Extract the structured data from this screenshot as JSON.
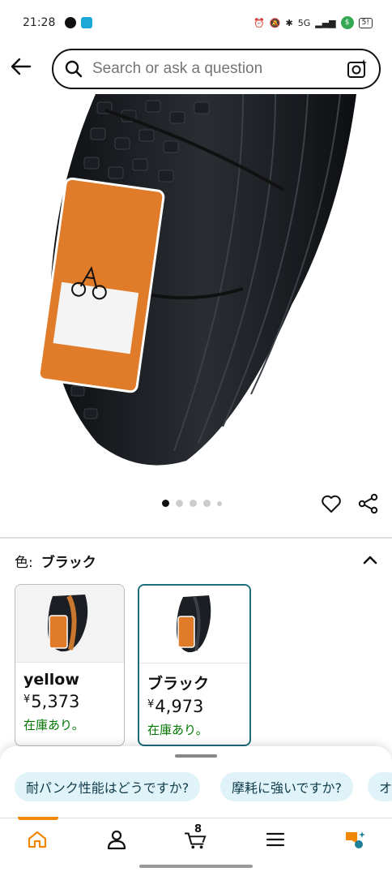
{
  "status_bar": {
    "time": "21:28",
    "network": "5G",
    "battery": "5!"
  },
  "search": {
    "placeholder": "Search or ask a question",
    "value": ""
  },
  "carousel": {
    "total_dots": 5,
    "active_index": 0
  },
  "variation": {
    "label": "色:",
    "selected_value": "ブラック",
    "options": [
      {
        "name": "yellow",
        "currency": "¥",
        "price": "5,373",
        "stock": "在庫あり。",
        "selected": false
      },
      {
        "name": "ブラック",
        "currency": "¥",
        "price": "4,973",
        "stock": "在庫あり。",
        "selected": true
      }
    ]
  },
  "rufus": {
    "chips": [
      "耐パンク性能はどうですか?",
      "摩耗に強いですか?",
      "オ"
    ]
  },
  "bottom_nav": {
    "cart_count": "8",
    "items": [
      "home-icon",
      "account-icon",
      "cart-icon",
      "menu-icon",
      "rufus-icon"
    ]
  },
  "colors": {
    "accent": "#f08804",
    "selected_border": "#1d6d7d",
    "in_stock": "#007600",
    "chip_bg": "#dff3f8"
  }
}
